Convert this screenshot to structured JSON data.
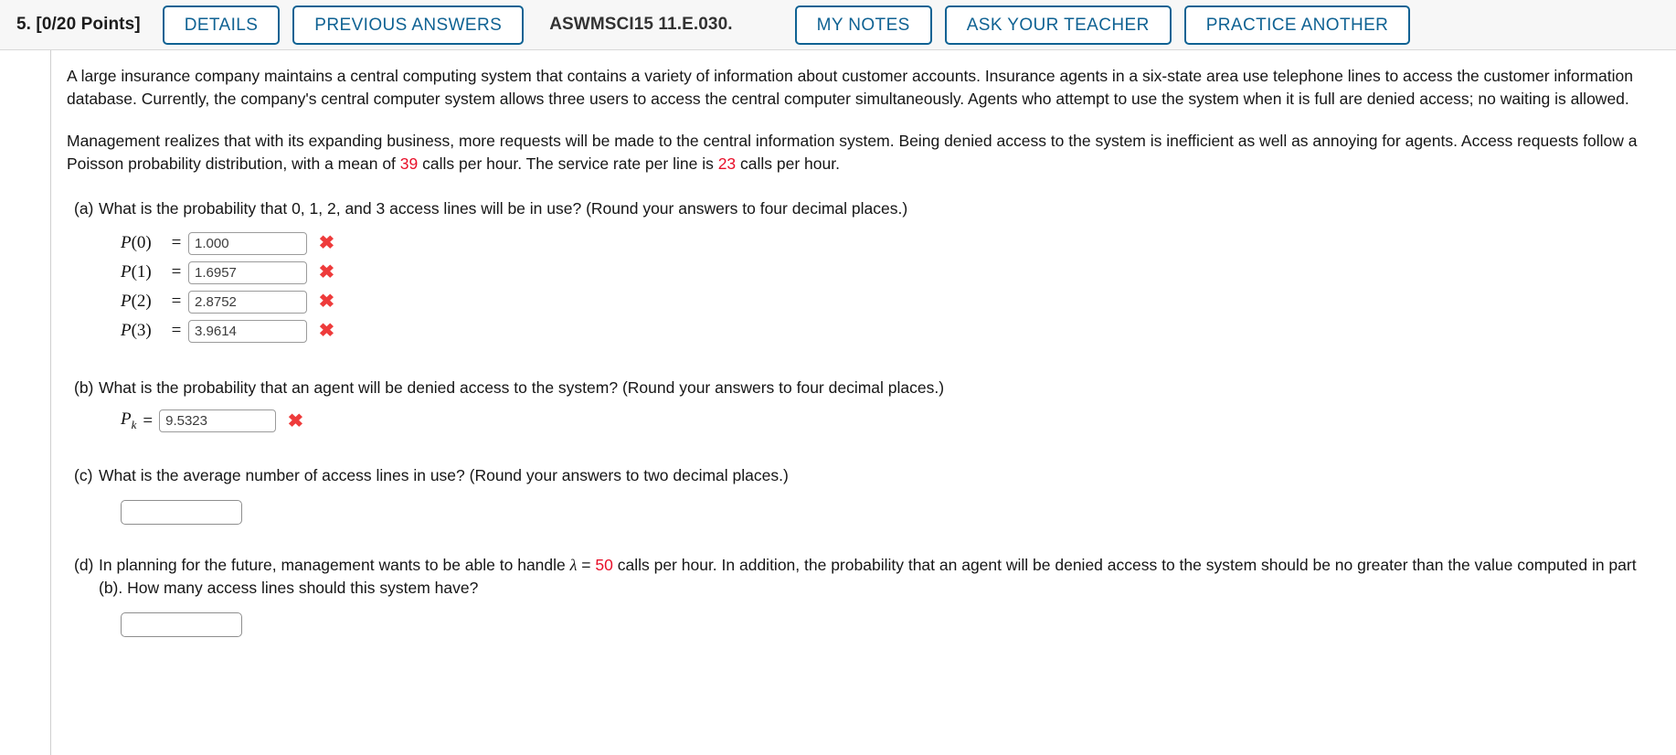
{
  "header": {
    "points_label": "5.  [0/20 Points]",
    "question_id": "ASWMSCI15 11.E.030.",
    "buttons": {
      "details": "DETAILS",
      "previous_answers": "PREVIOUS ANSWERS",
      "my_notes": "MY NOTES",
      "ask_your_teacher": "ASK YOUR TEACHER",
      "practice_another": "PRACTICE ANOTHER"
    },
    "accent_color": "#0f6293"
  },
  "problem": {
    "paragraph1": "A large insurance company maintains a central computing system that contains a variety of information about customer accounts. Insurance agents in a six-state area use telephone lines to access the customer information database. Currently, the company's central computer system allows three users to access the central computer simultaneously. Agents who attempt to use the system when it is full are denied access; no waiting is allowed.",
    "paragraph2_part1": "Management realizes that with its expanding business, more requests will be made to the central information system. Being denied access to the system is inefficient as well as annoying for agents. Access requests follow a Poisson probability distribution, with a mean of ",
    "mean_value": "39",
    "paragraph2_part2": " calls per hour. The service rate per line is ",
    "service_rate": "23",
    "paragraph2_part3": " calls per hour."
  },
  "parts": {
    "a": {
      "letter": "(a)",
      "question": "What is the probability that 0, 1, 2, and 3 access lines will be in use? (Round your answers to four decimal places.)",
      "rows": [
        {
          "label_p": "P",
          "label_arg": "(0)",
          "equals": "=",
          "value": "1.000",
          "status": "incorrect",
          "status_mark": "✖"
        },
        {
          "label_p": "P",
          "label_arg": "(1)",
          "equals": "=",
          "value": "1.6957",
          "status": "incorrect",
          "status_mark": "✖"
        },
        {
          "label_p": "P",
          "label_arg": "(2)",
          "equals": "=",
          "value": "2.8752",
          "status": "incorrect",
          "status_mark": "✖"
        },
        {
          "label_p": "P",
          "label_arg": "(3)",
          "equals": "=",
          "value": "3.9614",
          "status": "incorrect",
          "status_mark": "✖"
        }
      ]
    },
    "b": {
      "letter": "(b)",
      "question": "What is the probability that an agent will be denied access to the system? (Round your answers to four decimal places.)",
      "label_p": "P",
      "label_sub": "k",
      "equals": "=",
      "value": "9.5323",
      "status_mark": "✖"
    },
    "c": {
      "letter": "(c)",
      "question": "What is the average number of access lines in use? (Round your answers to two decimal places.)",
      "value": "",
      "placeholder": ""
    },
    "d": {
      "letter": "(d)",
      "question_part1": "In planning for the future, management wants to be able to handle ",
      "lambda_symbol": "λ",
      "equals": " = ",
      "lambda_value": "50",
      "question_part2": " calls per hour. In addition, the probability that an agent will be denied access to the system should be no greater than the value computed in part (b). How many access lines should this system have?",
      "value": "",
      "placeholder": ""
    }
  },
  "colors": {
    "red_value": "#e8102a",
    "incorrect_mark": "#ee3b3b",
    "button_border": "#0f6293"
  }
}
